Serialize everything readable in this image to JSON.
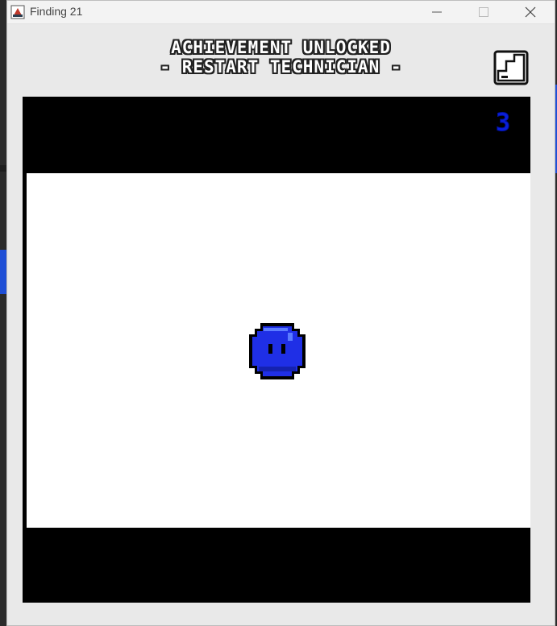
{
  "window": {
    "title": "Finding 21",
    "controls": [
      "minimize",
      "maximize",
      "close"
    ]
  },
  "banner": {
    "line1": "ACHIEVEMENT UNLOCKED",
    "line2": "- RESTART TECHNICIAN -"
  },
  "game": {
    "score": "3",
    "player_color": "#1f2fe6",
    "play_area_color": "#ffffff",
    "border_color": "#000000"
  },
  "icons": {
    "app": "java-app-icon",
    "exit": "exit-door-icon"
  }
}
